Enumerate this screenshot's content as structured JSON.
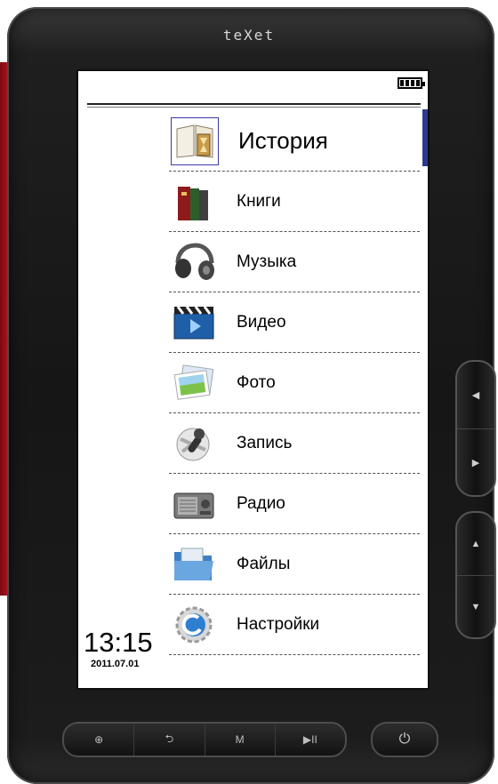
{
  "device": {
    "brand": "teXet",
    "battery_level": 1.0
  },
  "menu": {
    "items": [
      {
        "label": "История",
        "icon": "history-book-hourglass-icon",
        "selected": true
      },
      {
        "label": "Книги",
        "icon": "books-icon"
      },
      {
        "label": "Музыка",
        "icon": "headphones-icon"
      },
      {
        "label": "Видео",
        "icon": "clapperboard-video-icon"
      },
      {
        "label": "Фото",
        "icon": "photo-icon"
      },
      {
        "label": "Запись",
        "icon": "microphone-icon"
      },
      {
        "label": "Радио",
        "icon": "radio-icon"
      },
      {
        "label": "Файлы",
        "icon": "folder-files-icon"
      },
      {
        "label": "Настройки",
        "icon": "settings-gear-icon"
      }
    ]
  },
  "status": {
    "time": "13:15",
    "date": "2011.07.01"
  },
  "hardware": {
    "side_top": {
      "up": "◀",
      "down": "▶"
    },
    "side_bottom": {
      "up": "▲",
      "down": "▼"
    },
    "bottom": {
      "zoom": "⊕",
      "back": "⮌",
      "menu": "M",
      "play": "▶II"
    },
    "power": "⏻"
  },
  "colors": {
    "selection": "#2a3b8f",
    "accent_red": "#b3121f"
  }
}
